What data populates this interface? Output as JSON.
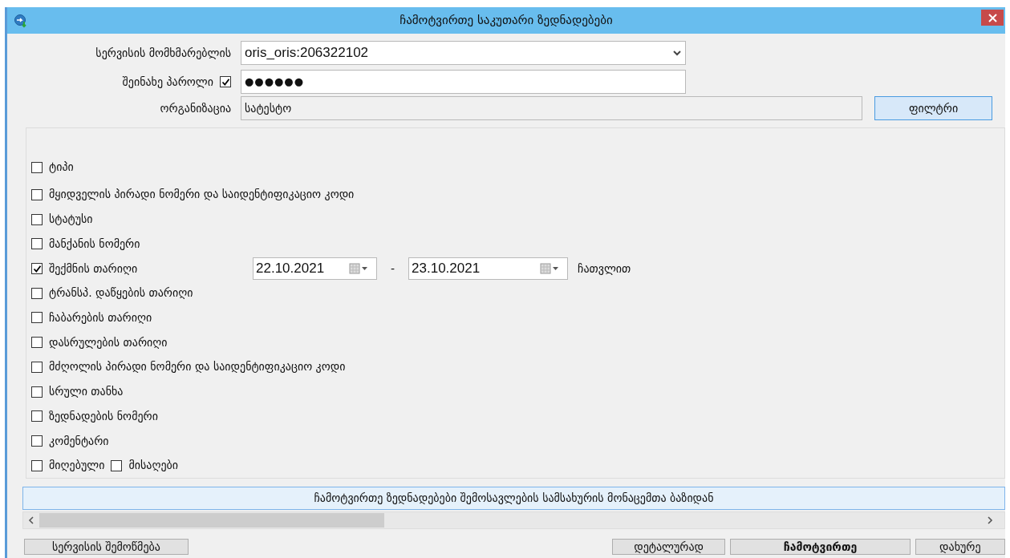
{
  "window": {
    "title": "ჩამოტვირთე საკუთარი ზედნადებები"
  },
  "form": {
    "service_user": {
      "label": "სერვისის მომხმარებლის",
      "value": "oris_oris:206322102"
    },
    "save_password": {
      "label": "შეინახე პაროლი",
      "checked": true,
      "value": "●●●●●●"
    },
    "organization": {
      "label": "ორგანიზაცია",
      "value": "სატესტო"
    },
    "filter_button": "ფილტრი"
  },
  "filters": [
    {
      "kind": "check",
      "label": "ტიპი",
      "checked": false
    },
    {
      "kind": "check",
      "label": "მყიდველის პირადი ნომერი და საიდენტიფიკაციო კოდი",
      "checked": false
    },
    {
      "kind": "check",
      "label": "სტატუსი",
      "checked": false
    },
    {
      "kind": "check",
      "label": "მანქანის ნომერი",
      "checked": false
    },
    {
      "kind": "daterange",
      "label": "შექმნის თარიღი",
      "checked": true,
      "from": "22.10.2021",
      "separator": "-",
      "to": "23.10.2021",
      "suffix": "ჩათვლით"
    },
    {
      "kind": "check",
      "label": "ტრანსპ. დაწყების თარიღი",
      "checked": false
    },
    {
      "kind": "check",
      "label": "ჩაბარების თარიღი",
      "checked": false
    },
    {
      "kind": "check",
      "label": "დასრულების თარიღი",
      "checked": false
    },
    {
      "kind": "check",
      "label": "მძღოლის პირადი ნომერი და საიდენტიფიკაციო კოდი",
      "checked": false
    },
    {
      "kind": "check",
      "label": "სრული თანხა",
      "checked": false
    },
    {
      "kind": "check",
      "label": "ზედნადების ნომერი",
      "checked": false
    },
    {
      "kind": "check",
      "label": "კომენტარი",
      "checked": false
    },
    {
      "kind": "pair",
      "label": "მიღებული",
      "checked": false,
      "label2": "მისაღები",
      "checked2": false
    }
  ],
  "download_banner": "ჩამოტვირთე ზედნადებები შემოსავლების სამსახურის მონაცემთა ბაზიდან",
  "buttons": [
    {
      "label": "სერვისის შემოწმება",
      "bold": false
    },
    {
      "label": "დეტალურად",
      "bold": false
    },
    {
      "label": "ჩამოტვირთე",
      "bold": true
    },
    {
      "label": "დახურე",
      "bold": false
    }
  ]
}
